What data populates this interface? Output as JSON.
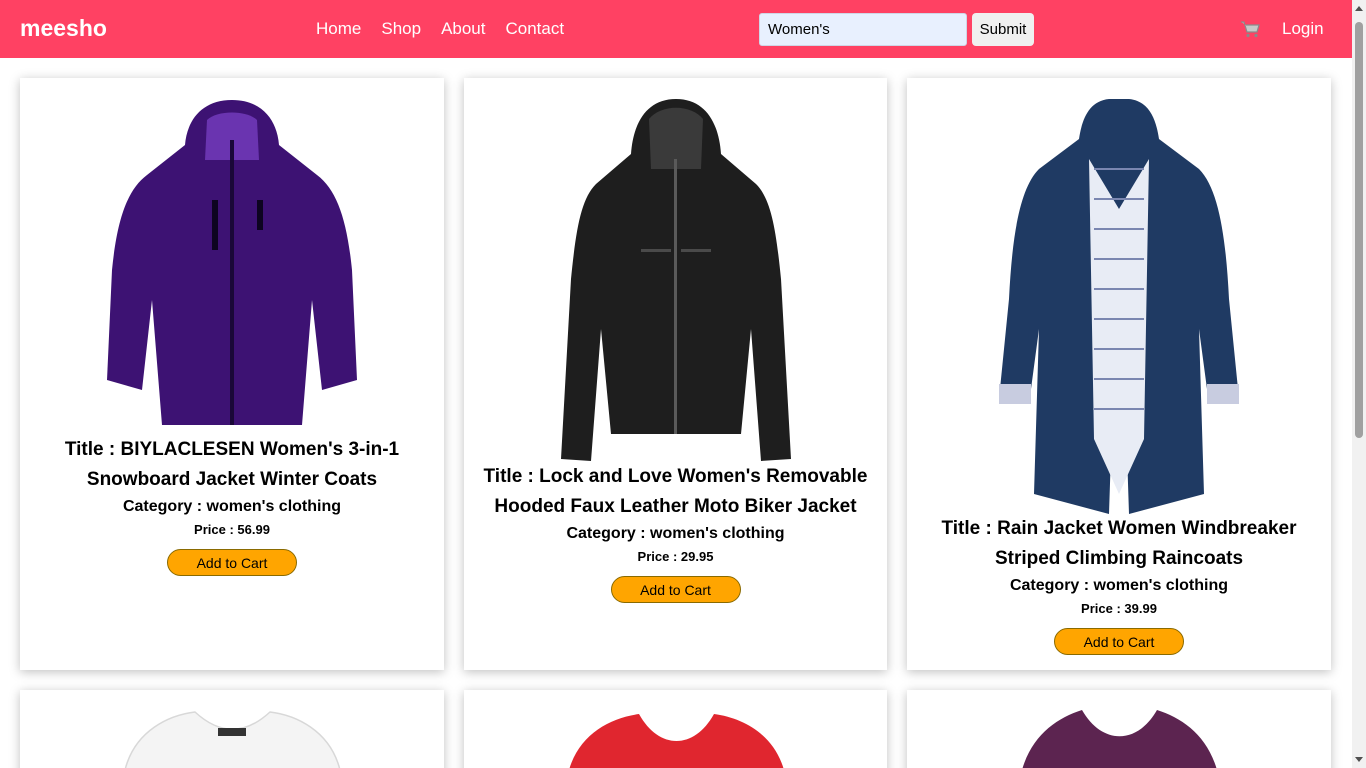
{
  "brand": "meesho",
  "nav": {
    "links": [
      "Home",
      "Shop",
      "About",
      "Contact"
    ]
  },
  "search": {
    "value": "Women's",
    "submit_label": "Submit"
  },
  "login_label": "Login",
  "colors": {
    "navbar": "#ff4163",
    "button": "#ffa500"
  },
  "products": [
    {
      "title": "Title : BIYLACLESEN Women's 3-in-1 Snowboard Jacket Winter Coats",
      "category": "Category : women's clothing",
      "price": "Price : 56.99",
      "button": "Add to Cart"
    },
    {
      "title": "Title : Lock and Love Women's Removable Hooded Faux Leather Moto Biker Jacket",
      "category": "Category : women's clothing",
      "price": "Price : 29.95",
      "button": "Add to Cart"
    },
    {
      "title": "Title : Rain Jacket Women Windbreaker Striped Climbing Raincoats",
      "category": "Category : women's clothing",
      "price": "Price : 39.99",
      "button": "Add to Cart"
    }
  ]
}
